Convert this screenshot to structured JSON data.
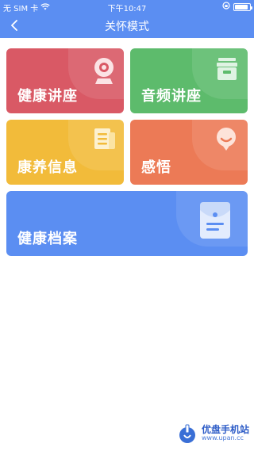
{
  "statusbar": {
    "carrier": "无 SIM 卡",
    "time": "下午10:47"
  },
  "navbar": {
    "title": "关怀模式"
  },
  "cards": {
    "health_lecture": "健康讲座",
    "audio_lecture": "音频讲座",
    "wellness_info": "康养信息",
    "insights": "感悟",
    "health_records": "健康档案"
  },
  "watermark": {
    "main": "优盘手机站",
    "sub": "www.upan.cc"
  },
  "colors": {
    "primary": "#5b8ef2",
    "red": "#d95965",
    "green": "#5dbb6c",
    "yellow": "#f2bb3a",
    "orange": "#ec7a56"
  }
}
